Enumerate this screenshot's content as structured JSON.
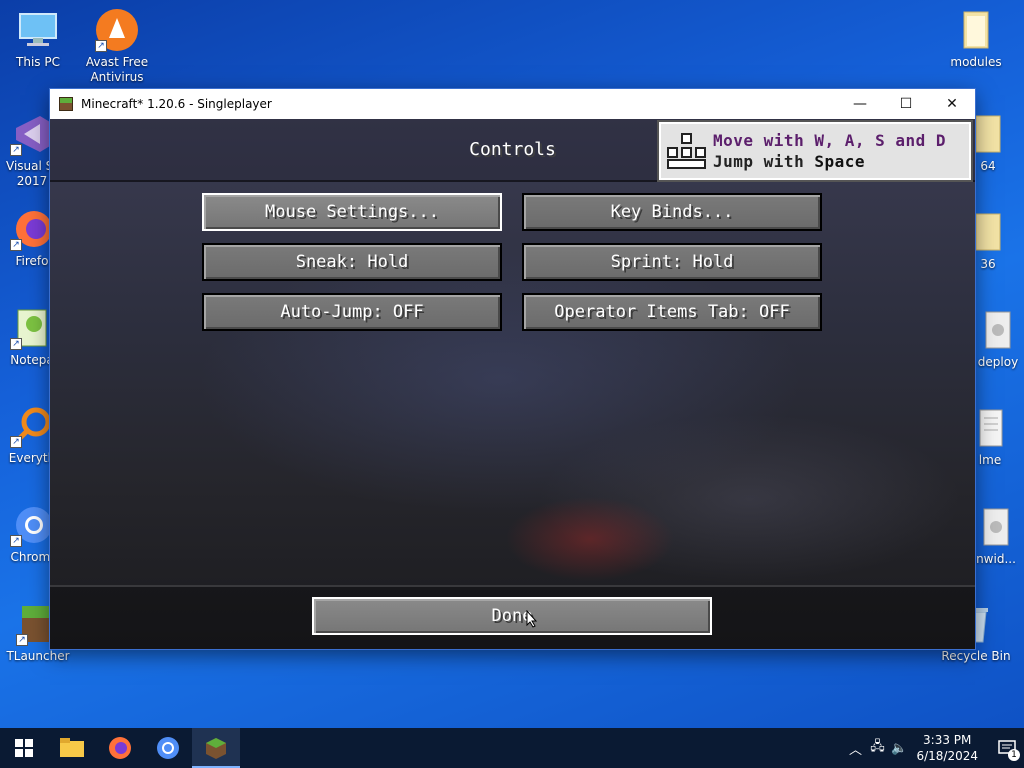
{
  "desktop": {
    "icons_left": [
      {
        "label": "This PC",
        "icon": "this-pc-icon"
      },
      {
        "label": "Avast Free Antivirus",
        "icon": "avast-icon"
      },
      {
        "label": "Visual St 2017",
        "icon": "visual-studio-icon"
      },
      {
        "label": "Firefo",
        "icon": "firefox-icon"
      },
      {
        "label": "Notepa",
        "icon": "notepad-icon"
      },
      {
        "label": "Everyth",
        "icon": "everything-search-icon"
      },
      {
        "label": "Chromi",
        "icon": "chromium-icon"
      },
      {
        "label": "TLauncher",
        "icon": "tlauncher-icon"
      }
    ],
    "icons_right": [
      {
        "label": "modules",
        "icon": "folder-icon"
      },
      {
        "label": "64",
        "icon": "folder-icon"
      },
      {
        "label": "36",
        "icon": "folder-icon"
      },
      {
        "label": "deploy",
        "icon": "file-icon"
      },
      {
        "label": "lme",
        "icon": "file-icon"
      },
      {
        "label": "nwid...",
        "icon": "file-icon"
      },
      {
        "label": "Recycle Bin",
        "icon": "recycle-bin-icon"
      }
    ]
  },
  "window": {
    "title": "Minecraft* 1.20.6 - Singleplayer",
    "minimize": "—",
    "maximize": "☐",
    "close": "✕"
  },
  "screen": {
    "title": "Controls",
    "toast": {
      "line1_prefix": "Move with ",
      "line1_keys": "W, A, S and D",
      "line2_prefix": "Jump with ",
      "line2_key": "Space"
    },
    "buttons": {
      "mouse_settings": "Mouse Settings...",
      "key_binds": "Key Binds...",
      "sneak": "Sneak: Hold",
      "sprint": "Sprint: Hold",
      "auto_jump": "Auto-Jump: OFF",
      "operator_tab": "Operator Items Tab: OFF",
      "done": "Done"
    }
  },
  "taskbar": {
    "apps": [
      "start-icon",
      "file-explorer-icon",
      "firefox-icon",
      "chromium-icon",
      "minecraft-icon"
    ],
    "time": "3:33 PM",
    "date": "6/18/2024",
    "notification_count": "1"
  },
  "colors": {
    "desktop_bg": "#1560d8",
    "button_face": "#727272",
    "toast_title": "#5c1f6c"
  }
}
